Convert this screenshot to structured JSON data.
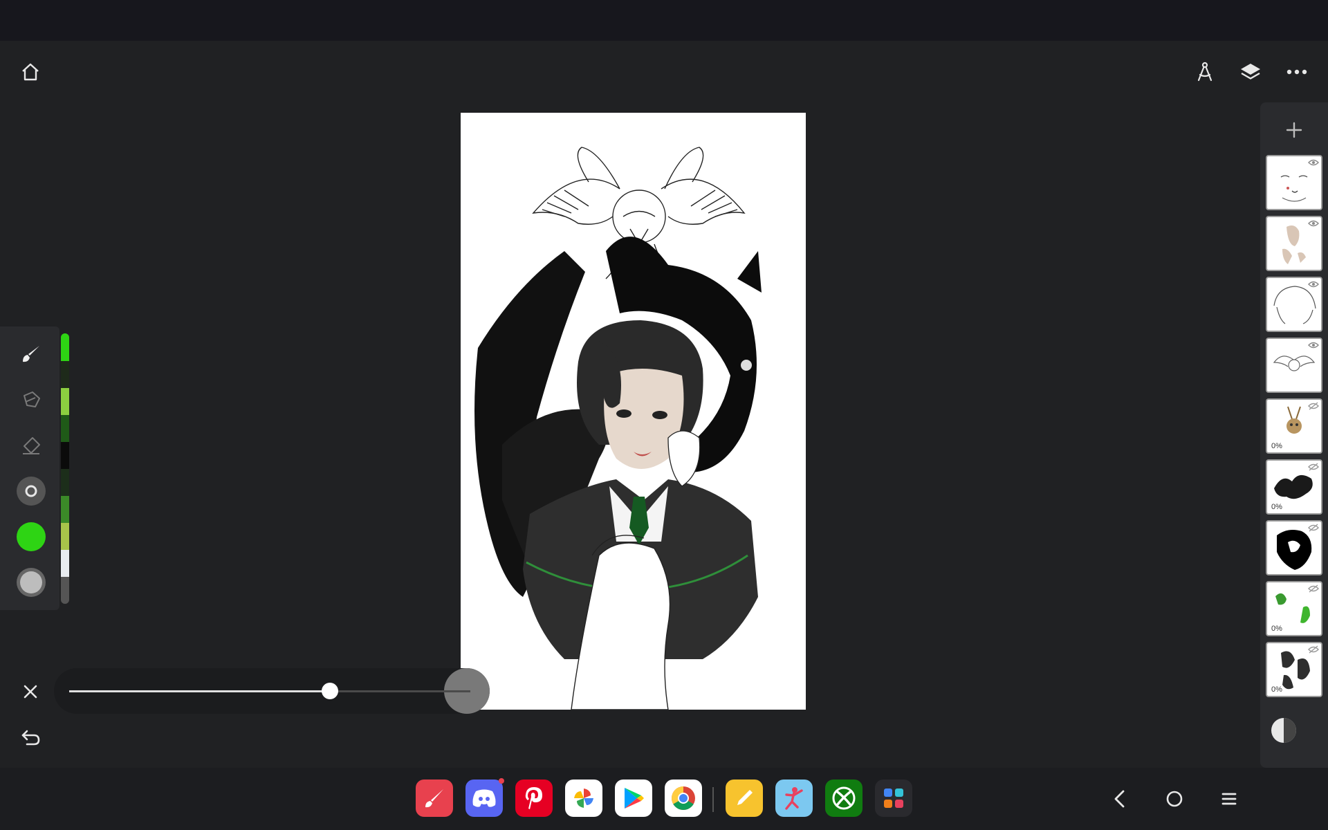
{
  "app": {
    "name": "Painting app",
    "accent_color": "#2ed414"
  },
  "topbar": {
    "home_icon": "home-icon",
    "right_icons": [
      "compass-ruler-icon",
      "layers-icon",
      "more-horizontal-icon"
    ]
  },
  "tools": [
    {
      "name": "brush-icon",
      "active": true
    },
    {
      "name": "lasso-icon",
      "active": false
    },
    {
      "name": "eraser-icon",
      "active": false
    },
    {
      "name": "brush-size-icon",
      "active": false
    },
    {
      "name": "color-picker-icon",
      "color": "#2ed414"
    },
    {
      "name": "opacity-icon",
      "color": "#bdbdbd"
    }
  ],
  "palette": {
    "colors": [
      "#2ed414",
      "#1e2a1a",
      "#8cd040",
      "#1f5a18",
      "#0b0b0b",
      "#1c2e1a",
      "#3b8a28",
      "#a8c44a",
      "#e8ecf0",
      "#555555"
    ]
  },
  "slider": {
    "value": 0.65,
    "close_icon": "close-icon",
    "undo_icon": "undo-icon"
  },
  "layers": {
    "add_icon": "plus-icon",
    "items": [
      {
        "thumb": "face-lines",
        "visible": true,
        "opacity_label": ""
      },
      {
        "thumb": "skin",
        "visible": true,
        "opacity_label": ""
      },
      {
        "thumb": "hair-lines",
        "visible": true,
        "opacity_label": ""
      },
      {
        "thumb": "owl-lines",
        "visible": true,
        "opacity_label": ""
      },
      {
        "thumb": "creature",
        "visible": false,
        "opacity_label": "0%"
      },
      {
        "thumb": "dragon-dark",
        "visible": false,
        "opacity_label": "0%"
      },
      {
        "thumb": "dragon-black",
        "visible": false,
        "opacity_label": ""
      },
      {
        "thumb": "green-strokes",
        "visible": false,
        "opacity_label": "0%"
      },
      {
        "thumb": "dark-shapes",
        "visible": false,
        "opacity_label": "0%"
      }
    ],
    "blend_icon": "half-circle-icon"
  },
  "dock": {
    "apps": [
      {
        "name": "brush-app-icon",
        "bg": "#e8414e"
      },
      {
        "name": "discord-icon",
        "bg": "#5865f2"
      },
      {
        "name": "pinterest-icon",
        "bg": "#e60023"
      },
      {
        "name": "photos-icon",
        "bg": "#ffffff"
      },
      {
        "name": "play-store-icon",
        "bg": "#ffffff"
      },
      {
        "name": "chrome-icon",
        "bg": "#ffffff"
      },
      {
        "name": "notes-icon",
        "bg": "#f7c32e"
      },
      {
        "name": "dance-app-icon",
        "bg": "#7cc8f0"
      },
      {
        "name": "xbox-icon",
        "bg": "#107c10"
      },
      {
        "name": "app-drawer-icon",
        "bg": "#2a2a2e"
      }
    ],
    "nav": [
      "back-icon",
      "home-circle-icon",
      "recents-icon"
    ]
  }
}
